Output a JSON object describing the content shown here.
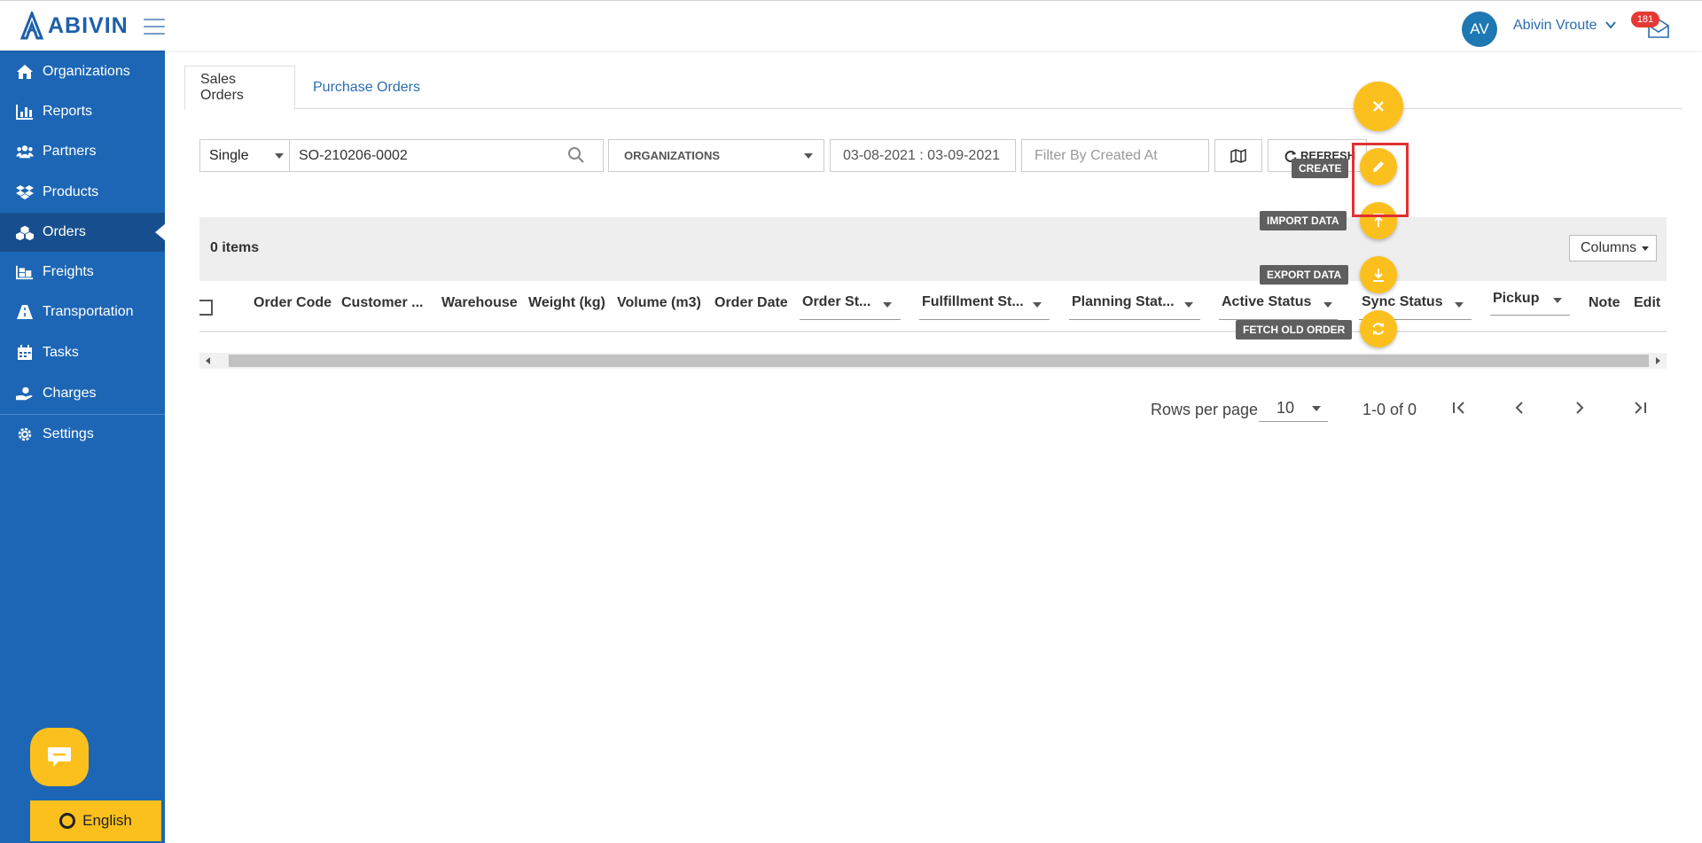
{
  "app": {
    "brand": "ABIVIN"
  },
  "header": {
    "user_initials": "AV",
    "user_name": "Abivin Vroute",
    "notification_count": "181"
  },
  "sidebar": {
    "items": [
      {
        "label": "Organizations",
        "icon": "home-icon"
      },
      {
        "label": "Reports",
        "icon": "bar-chart-icon"
      },
      {
        "label": "Partners",
        "icon": "users-icon"
      },
      {
        "label": "Products",
        "icon": "dropbox-icon"
      },
      {
        "label": "Orders",
        "icon": "cubes-icon",
        "active": true
      },
      {
        "label": "Freights",
        "icon": "pallet-icon"
      },
      {
        "label": "Transportation",
        "icon": "road-icon"
      },
      {
        "label": "Tasks",
        "icon": "calendar-icon"
      },
      {
        "label": "Charges",
        "icon": "hand-coin-icon"
      },
      {
        "label": "Settings",
        "icon": "gear-icon"
      }
    ],
    "language": "English"
  },
  "tabs": [
    {
      "label": "Sales Orders",
      "active": true
    },
    {
      "label": "Purchase Orders",
      "active": false
    }
  ],
  "filters": {
    "search_mode": "Single",
    "search_value": "SO-210206-0002",
    "organizations": "ORGANIZATIONS",
    "date_range": "03-08-2021 : 03-09-2021",
    "created_at_placeholder": "Filter By Created At",
    "refresh_label": "REFRESH"
  },
  "table": {
    "items_count": "0 items",
    "columns_button": "Columns",
    "columns": [
      "Order Code",
      "Customer ...",
      "Warehouse",
      "Weight (kg)",
      "Volume (m3)",
      "Order Date",
      "Order St...",
      "Fulfillment St...",
      "Planning Stat...",
      "Active Status",
      "Sync Status",
      "Pickup",
      "Note",
      "Edit"
    ]
  },
  "pagination": {
    "rows_per_page_label": "Rows per page",
    "rows_per_page": "10",
    "range": "1-0 of 0"
  },
  "fab": {
    "actions": [
      {
        "label": "CREATE",
        "icon": "pencil-icon"
      },
      {
        "label": "IMPORT DATA",
        "icon": "upload-icon"
      },
      {
        "label": "EXPORT DATA",
        "icon": "download-icon"
      },
      {
        "label": "FETCH OLD ORDER",
        "icon": "sync-icon"
      }
    ]
  },
  "colors": {
    "primary": "#1d66b5",
    "accent": "#fcc01e",
    "highlight": "#e03131"
  }
}
